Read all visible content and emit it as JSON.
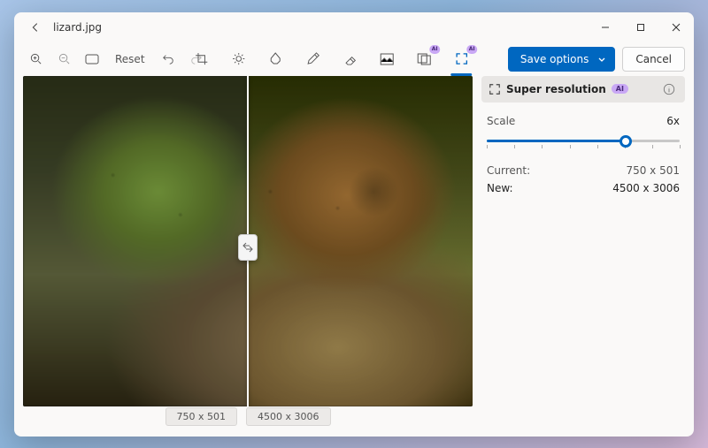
{
  "window": {
    "title": "lizard.jpg"
  },
  "toolbar": {
    "reset_label": "Reset",
    "save_label": "Save options",
    "cancel_label": "Cancel"
  },
  "panel": {
    "title": "Super resolution",
    "ai_badge": "AI",
    "scale_label": "Scale",
    "scale_value": "6x",
    "scale_fraction": 0.72,
    "current_label": "Current:",
    "current_value": "750 x 501",
    "new_label": "New:",
    "new_value": "4500 x 3006"
  },
  "compare": {
    "left_tag": "750 x 501",
    "right_tag": "4500 x 3006"
  },
  "icons": {
    "ai_small": "AI"
  }
}
